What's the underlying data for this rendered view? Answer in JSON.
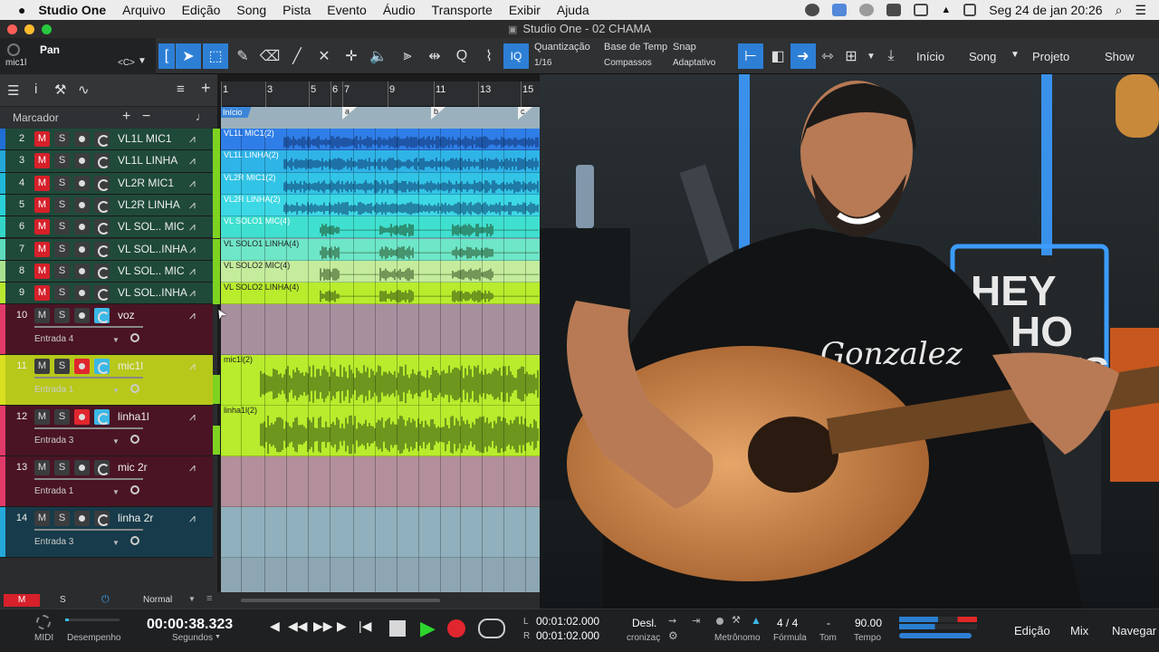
{
  "menubar": {
    "app": "Studio One",
    "items": [
      "Arquivo",
      "Edição",
      "Song",
      "Pista",
      "Evento",
      "Áudio",
      "Transporte",
      "Exibir",
      "Ajuda"
    ],
    "datetime": "Seg 24 de jan  20:26"
  },
  "window": {
    "title": "Studio One - 02 CHAMA"
  },
  "inspector": {
    "param": "Pan",
    "track": "mic1l",
    "value": "<C>"
  },
  "toolbar": {
    "quantize_label": "Quantização",
    "quantize_value": "1/16",
    "timebase_label": "Base de Temp",
    "timebase_value": "Compassos",
    "snap_label": "Snap",
    "snap_value": "Adaptativo",
    "iq": "IQ",
    "nav": [
      "Início",
      "Song",
      "Projeto",
      "Show"
    ]
  },
  "marker_panel": {
    "label": "Marcador"
  },
  "ruler": {
    "ticks": [
      "1",
      "3",
      "5",
      "6",
      "7",
      "9",
      "11",
      "13",
      "15"
    ]
  },
  "markers": {
    "start": "Início",
    "items": [
      "a",
      "b",
      "c"
    ]
  },
  "tracks": [
    {
      "num": "2",
      "name": "VL1L MIC1",
      "color": "#1f6fd6",
      "clip": "VL1L MIC1(2)",
      "clipcolor": "#2f7ee8",
      "mute": true
    },
    {
      "num": "3",
      "name": "VL1L LINHA",
      "color": "#23a8d8",
      "clip": "VL1L LINHA(2)",
      "clipcolor": "#2fb4e8",
      "mute": true
    },
    {
      "num": "4",
      "name": "VL2R MIC1",
      "color": "#1fb8d8",
      "clip": "VL2R MIC1(2)",
      "clipcolor": "#32c4e6",
      "mute": true
    },
    {
      "num": "5",
      "name": "VL2R LINHA",
      "color": "#2ad0d8",
      "clip": "VL2R LINHA(2)",
      "clipcolor": "#3cd8e6",
      "mute": true
    },
    {
      "num": "6",
      "name": "VL SOL.. MIC",
      "color": "#33d6c6",
      "clip": "VL SOLO1 MIC(4)",
      "clipcolor": "#40e0d0",
      "mute": true
    },
    {
      "num": "7",
      "name": "VL SOL..INHA",
      "color": "#5cdcbc",
      "clip": "VL SOLO1 LINHA(4)",
      "clipcolor": "#6ee6c8",
      "mute": true
    },
    {
      "num": "8",
      "name": "VL SOL.. MIC",
      "color": "#a8e090",
      "clip": "VL SOLO2 MIC(4)",
      "clipcolor": "#c4ec9c",
      "mute": true
    },
    {
      "num": "9",
      "name": "VL SOL..INHA",
      "color": "#b8e830",
      "clip": "VL SOLO2 LINHA(4)",
      "clipcolor": "#b8ec2c",
      "mute": true
    },
    {
      "num": "10",
      "name": "voz",
      "color": "#e03a6a",
      "input": "Entrada 4",
      "armed": false,
      "monitor": true
    },
    {
      "num": "11",
      "name": "mic1l",
      "color": "#d8e020",
      "input": "Entrada 1",
      "armed": true,
      "monitor": true,
      "clip": "mic1l(2)",
      "selected": true
    },
    {
      "num": "12",
      "name": "linha1l",
      "color": "#e03a6a",
      "input": "Entrada 3",
      "armed": true,
      "monitor": true,
      "clip": "linha1l(2)"
    },
    {
      "num": "13",
      "name": "mic 2r",
      "color": "#e03a6a",
      "input": "Entrada 1",
      "armed": false,
      "monitor": false
    },
    {
      "num": "14",
      "name": "linha 2r",
      "color": "#23a8d8",
      "input": "Entrada 3",
      "armed": false,
      "monitor": false
    }
  ],
  "bottomstrip": {
    "m": "M",
    "s": "S",
    "mode": "Normal"
  },
  "transport": {
    "midi": "MIDI",
    "perf": "Desempenho",
    "time": "00:00:38.323",
    "time_unit": "Segundos",
    "loop_l": "00:01:02.000",
    "loop_r": "00:01:02.000",
    "l": "L",
    "r": "R",
    "sync": "Desl.",
    "sync_sub": "cronizaç",
    "metronome": "Metrônomo",
    "signature": "4 / 4",
    "signature_label": "Fórmula",
    "key": "-",
    "key_label": "Tom",
    "tempo": "90.00",
    "tempo_label": "Tempo",
    "pages": [
      "Edição",
      "Mix",
      "Navegar"
    ]
  },
  "video": {
    "shirt_text": "HEY HO LETS GO",
    "tshirt_script": "Gonzalez"
  }
}
